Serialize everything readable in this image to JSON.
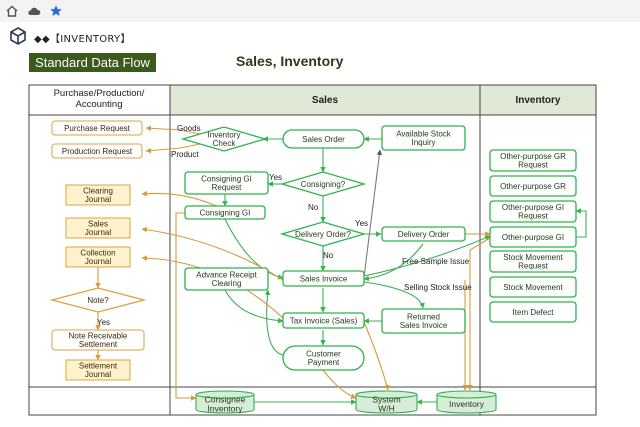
{
  "toolbar": {
    "icons": [
      "home-icon",
      "cloud-icon",
      "star-icon"
    ]
  },
  "app": {
    "title": "◆◆【INVENTORY】",
    "icon": "box-icon"
  },
  "header": {
    "standard_label": "Standard Data Flow",
    "title": "Sales, Inventory"
  },
  "lanes": {
    "left": "Purchase/Production/\nAccounting",
    "middle": "Sales",
    "right": "Inventory"
  },
  "left_nodes": {
    "purchase_request": "Purchase Request",
    "production_request": "Production Request",
    "clearing_journal": "Clearing\nJournal",
    "sales_journal": "Sales\nJournal",
    "collection_journal": "Collection\nJournal",
    "note_decision": "Note?",
    "note_yes": "Yes",
    "note_receivable": "Note Receivable\nSettlement",
    "settlement_journal": "Settlement\nJournal"
  },
  "sales_nodes": {
    "inventory_check": "Inventory\nCheck",
    "sales_order": "Sales Order",
    "available_stock": "Available Stock\nInquiry",
    "consigning_gi_request": "Consigning GI\nRequest",
    "consigning_decision": "Consigning?",
    "consigning_gi": "Consigning GI",
    "delivery_decision": "Delivery Order?",
    "delivery_order": "Delivery Order",
    "advance_receipt": "Advance Receipt\nClearing",
    "sales_invoice": "Sales Invoice",
    "tax_invoice": "Tax Invoice (Sales)",
    "returned_invoice": "Returned\nSales Invoice",
    "customer_payment": "Customer\nPayment"
  },
  "edge_labels": {
    "goods": "Goods",
    "product": "Product",
    "yes_consign": "Yes",
    "no_consign": "No",
    "yes_delivery": "Yes",
    "no_delivery": "No",
    "free_sample": "Free Sample Issue",
    "selling_stock": "Selling Stock Issue"
  },
  "inventory_nodes": {
    "other_gr_request": "Other-purpose GR\nRequest",
    "other_gr": "Other-purpose GR",
    "other_gi_request": "Other-purpose GI\nRequest",
    "other_gi": "Other-purpose GI",
    "stock_movement_request": "Stock Movement\nRequest",
    "stock_movement": "Stock Movement",
    "item_defect": "Item Defect"
  },
  "databases": {
    "consignee_inventory": "Consignee\nInventory",
    "system_wh": "System\nW/H",
    "inventory": "Inventory"
  },
  "colors": {
    "green_border": "#2db34a",
    "green_text": "#1e3a14",
    "orange_border": "#d9a441",
    "orange_fill": "#fff2cc",
    "lane_header": "#dfe9d6",
    "db_fill": "#d7ecd9",
    "arrow_orange": "#d89a3a",
    "arrow_green": "#3cb054",
    "arrow_gray": "#555555"
  }
}
